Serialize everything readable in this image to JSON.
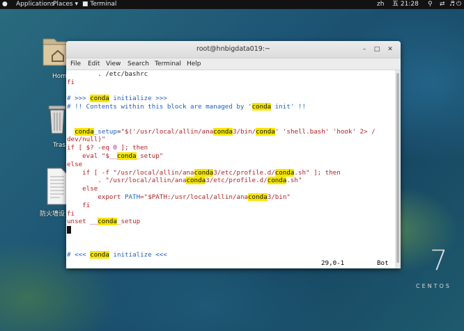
{
  "topbar": {
    "applications": "Applications",
    "places": "Places",
    "terminal": "Terminal",
    "lang": "zh",
    "clock": "五 21:28",
    "colors": {
      "bg": "#121212"
    }
  },
  "desktop": {
    "icons": [
      {
        "label": "Hom",
        "icon": "home-folder-icon"
      },
      {
        "label": "Tras",
        "icon": "trash-icon"
      },
      {
        "label": "防火墙设",
        "icon": "document-icon"
      }
    ],
    "logo_number": "7",
    "logo_text": "CENTOS"
  },
  "window": {
    "title": "root@hnbigdata019:~",
    "menu": [
      "File",
      "Edit",
      "View",
      "Search",
      "Terminal",
      "Help"
    ]
  },
  "terminal": {
    "lines": [
      [
        {
          "t": "        . /etc/bashrc",
          "c": "c-dark"
        }
      ],
      [
        {
          "t": "fi",
          "c": "c-red"
        }
      ],
      [
        {
          "t": "",
          "c": "c-dark"
        }
      ],
      [
        {
          "t": "# >>> ",
          "c": "c-blue"
        },
        {
          "t": "conda",
          "c": "hl"
        },
        {
          "t": " initialize >>>",
          "c": "c-blue"
        }
      ],
      [
        {
          "t": "# !! Contents within this block are managed by '",
          "c": "c-blue"
        },
        {
          "t": "conda",
          "c": "hl"
        },
        {
          "t": " init' !!",
          "c": "c-blue"
        }
      ],
      [
        {
          "t": "",
          "c": "c-dark"
        }
      ],
      [
        {
          "t": "",
          "c": "c-dark"
        }
      ],
      [
        {
          "t": "  ",
          "c": "c-dark"
        },
        {
          "t": "conda",
          "c": "hl"
        },
        {
          "t": "_setup",
          "c": "c-blue"
        },
        {
          "t": "=",
          "c": "c-dark"
        },
        {
          "t": "\"$('/usr/local/allin/ana",
          "c": "c-red"
        },
        {
          "t": "conda",
          "c": "hl"
        },
        {
          "t": "3/bin/",
          "c": "c-red"
        },
        {
          "t": "conda",
          "c": "hl"
        },
        {
          "t": "' 'shell.bash' 'hook' 2> /",
          "c": "c-red"
        }
      ],
      [
        {
          "t": "dev/null)\"",
          "c": "c-red"
        }
      ],
      [
        {
          "t": "if [ $? -eq ",
          "c": "c-red"
        },
        {
          "t": "0",
          "c": "c-mag"
        },
        {
          "t": " ]; then",
          "c": "c-red"
        }
      ],
      [
        {
          "t": "    eval \"$__",
          "c": "c-red"
        },
        {
          "t": "conda",
          "c": "hl"
        },
        {
          "t": "_setup\"",
          "c": "c-red"
        }
      ],
      [
        {
          "t": "else",
          "c": "c-red"
        }
      ],
      [
        {
          "t": "    if [ -f \"/usr/local/allin/ana",
          "c": "c-red"
        },
        {
          "t": "conda",
          "c": "hl"
        },
        {
          "t": "3/etc/profile.d/",
          "c": "c-red"
        },
        {
          "t": "conda",
          "c": "hl"
        },
        {
          "t": ".sh\" ]; then",
          "c": "c-red"
        }
      ],
      [
        {
          "t": "        . \"/usr/local/allin/ana",
          "c": "c-red"
        },
        {
          "t": "conda",
          "c": "hl"
        },
        {
          "t": "3/etc/profile.d/",
          "c": "c-red"
        },
        {
          "t": "conda",
          "c": "hl"
        },
        {
          "t": ".sh\"",
          "c": "c-red"
        }
      ],
      [
        {
          "t": "    else",
          "c": "c-red"
        }
      ],
      [
        {
          "t": "        export ",
          "c": "c-red"
        },
        {
          "t": "PATH",
          "c": "c-blue"
        },
        {
          "t": "=\"$PATH:/usr/local/allin/ana",
          "c": "c-red"
        },
        {
          "t": "conda",
          "c": "hl"
        },
        {
          "t": "3/bin\"",
          "c": "c-red"
        }
      ],
      [
        {
          "t": "    fi",
          "c": "c-red"
        }
      ],
      [
        {
          "t": "fi",
          "c": "c-red"
        }
      ],
      [
        {
          "t": "unset __",
          "c": "c-red"
        },
        {
          "t": "conda",
          "c": "hl"
        },
        {
          "t": "_setup",
          "c": "c-red"
        }
      ],
      [
        {
          "t": "__CURSOR__",
          "c": "c-dark"
        }
      ],
      [
        {
          "t": "",
          "c": "c-dark"
        }
      ],
      [
        {
          "t": "",
          "c": "c-dark"
        }
      ],
      [
        {
          "t": "# <<< ",
          "c": "c-blue"
        },
        {
          "t": "conda",
          "c": "hl"
        },
        {
          "t": " initialize <<<",
          "c": "c-blue"
        }
      ]
    ],
    "status_pos": "29,0-1",
    "status_scroll": "Bot"
  }
}
